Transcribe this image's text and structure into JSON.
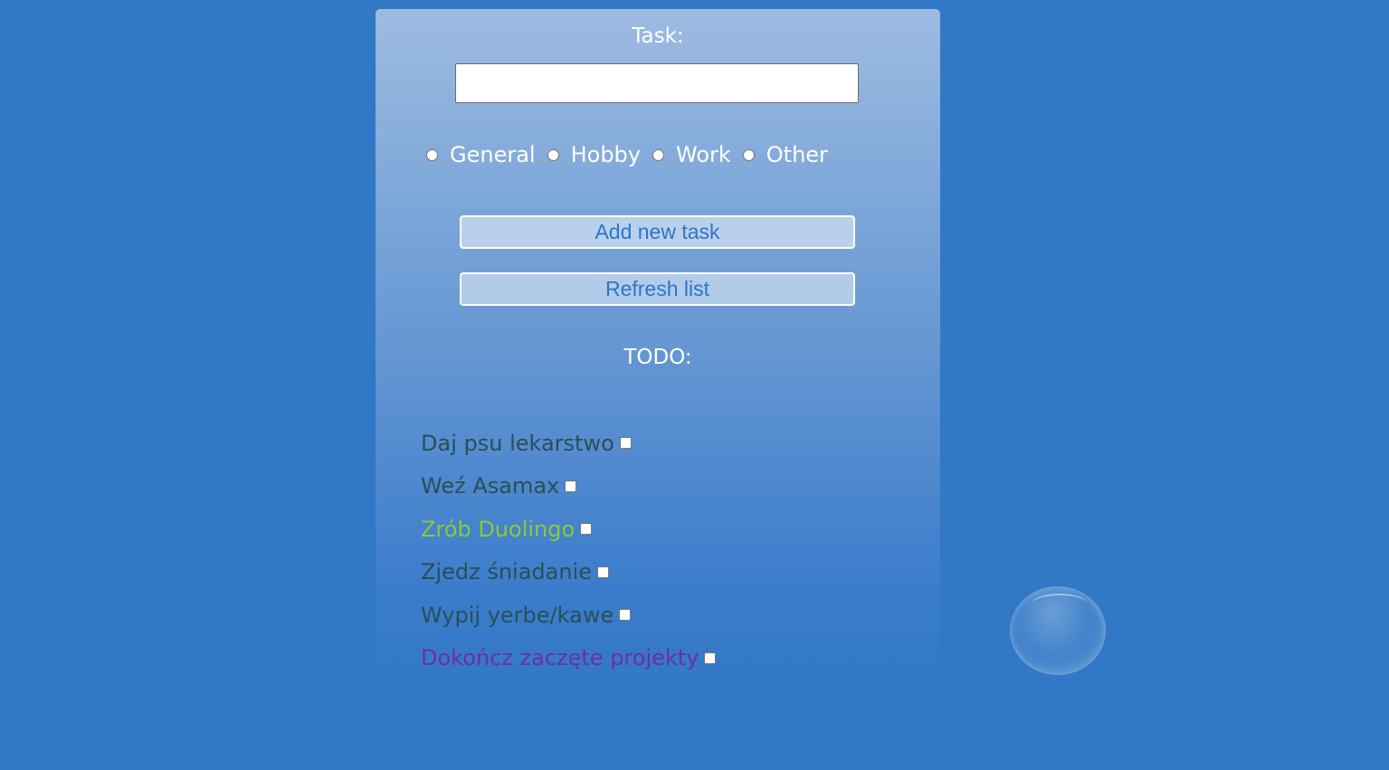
{
  "form": {
    "task_label": "Task:",
    "task_input_value": "",
    "categories": [
      "General",
      "Hobby",
      "Work",
      "Other"
    ],
    "add_button_label": "Add new task",
    "refresh_button_label": "Refresh list"
  },
  "todo": {
    "title": "TODO:",
    "items": [
      {
        "text": "Daj psu lekarstwo",
        "color": "#2b4f57",
        "checked": false
      },
      {
        "text": "Weź Asamax",
        "color": "#2b4f57",
        "checked": false
      },
      {
        "text": "Zrób Duolingo",
        "color": "#8bc83a",
        "checked": false
      },
      {
        "text": "Zjedz śniadanie",
        "color": "#2b4f57",
        "checked": false
      },
      {
        "text": "Wypij yerbe/kawe",
        "color": "#2b4f57",
        "checked": false
      },
      {
        "text": "Dokończ zaczęte projekty",
        "color": "#6f2f9e",
        "checked": false
      }
    ]
  },
  "colors": {
    "background": "#3178c6",
    "button_text": "#2f74c7"
  }
}
